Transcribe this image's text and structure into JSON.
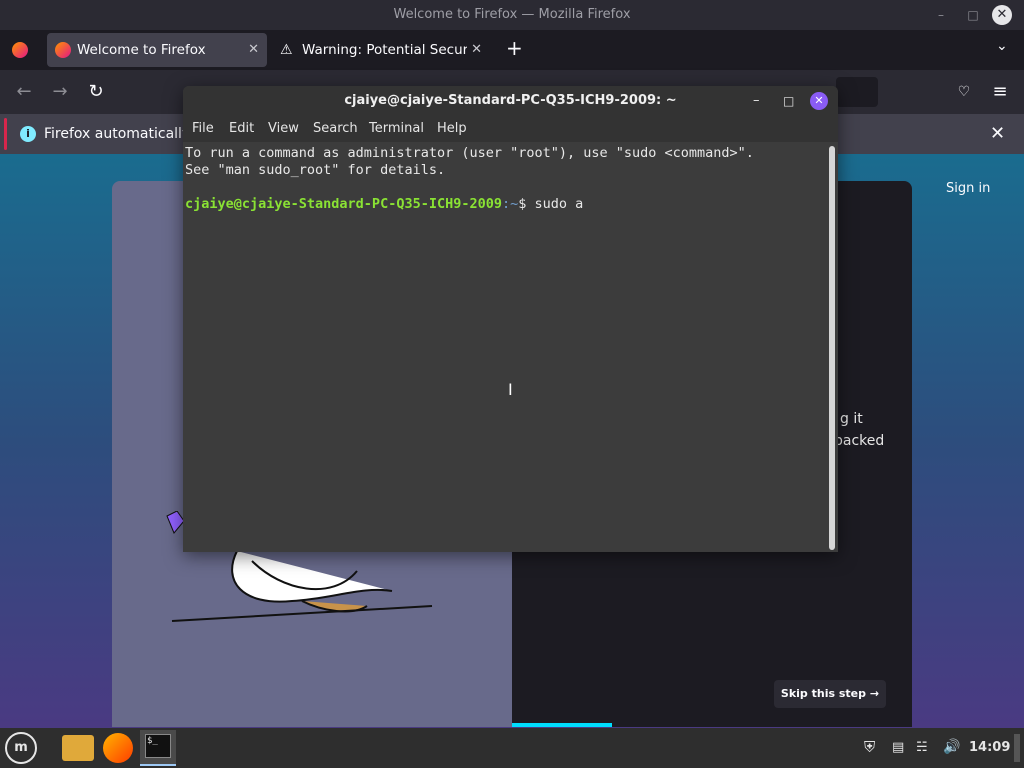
{
  "firefox": {
    "window_title": "Welcome to Firefox — Mozilla Firefox",
    "tabs": [
      {
        "label": "Welcome to Firefox"
      },
      {
        "label": "Warning: Potential Security"
      }
    ],
    "notification_text": "Firefox automatically s",
    "page": {
      "signin": "Sign in",
      "partial_text_1": "g it",
      "partial_text_2": "packed",
      "skip_label": "Skip this step →"
    }
  },
  "terminal": {
    "title": "cjaiye@cjaiye-Standard-PC-Q35-ICH9-2009: ~",
    "menu": [
      "File",
      "Edit",
      "View",
      "Search",
      "Terminal",
      "Help"
    ],
    "lines": [
      "To run a command as administrator (user \"root\"), use \"sudo <command>\".",
      "See \"man sudo_root\" for details."
    ],
    "prompt_user": "cjaiye@cjaiye-Standard-PC-Q35-ICH9-2009",
    "prompt_path": ":~",
    "prompt_symbol": "$ ",
    "command": "sudo a"
  },
  "taskbar": {
    "time": "14:09"
  },
  "colors": {
    "prompt_green": "#8ae234",
    "prompt_path": "#729fcf",
    "terminal_close": "#8a5cf5"
  }
}
